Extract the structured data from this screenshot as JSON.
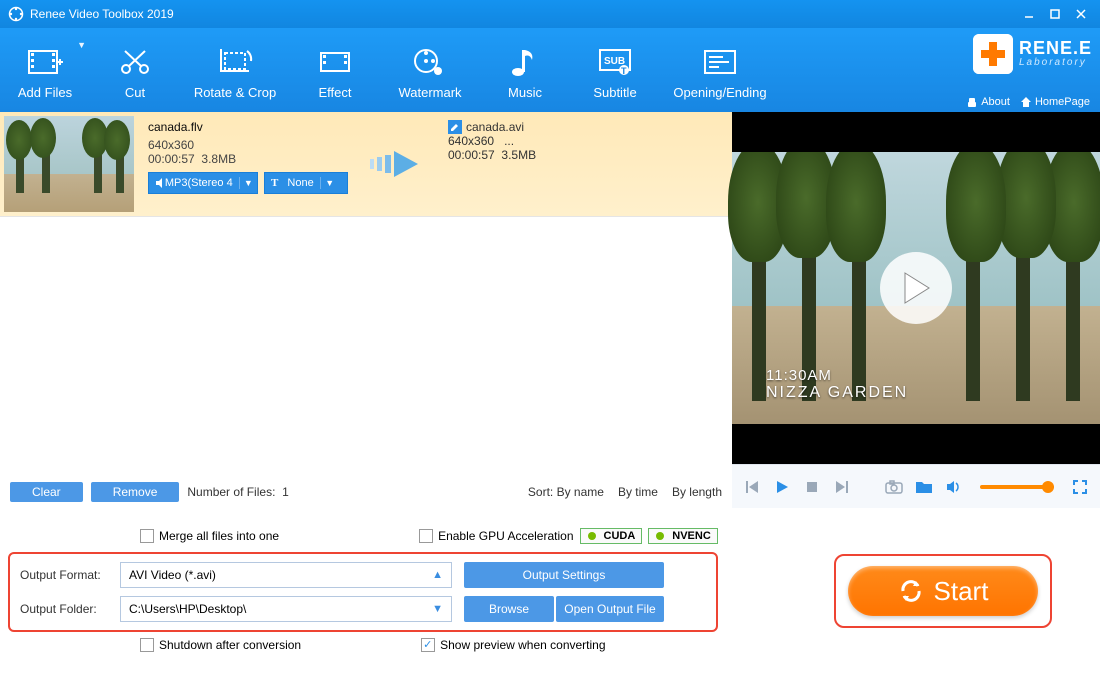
{
  "titlebar": {
    "title": "Renee Video Toolbox 2019"
  },
  "toolbar": {
    "items": [
      {
        "label": "Add Files",
        "icon": "film-add"
      },
      {
        "label": "Cut",
        "icon": "scissors"
      },
      {
        "label": "Rotate & Crop",
        "icon": "crop"
      },
      {
        "label": "Effect",
        "icon": "film"
      },
      {
        "label": "Watermark",
        "icon": "watermark"
      },
      {
        "label": "Music",
        "icon": "music"
      },
      {
        "label": "Subtitle",
        "icon": "subtitle"
      },
      {
        "label": "Opening/Ending",
        "icon": "opening"
      }
    ],
    "brand": {
      "name": "RENE.E",
      "sub": "Laboratory",
      "about": "About",
      "homepage": "HomePage"
    }
  },
  "file": {
    "src": {
      "name": "canada.flv",
      "dim": "640x360",
      "dur": "00:00:57",
      "size": "3.8MB",
      "audio": "MP3(Stereo 4",
      "sub": "None"
    },
    "dst": {
      "name": "canada.avi",
      "dim": "640x360",
      "dim_extra": "...",
      "dur": "00:00:57",
      "size": "3.5MB",
      "extra": "-"
    }
  },
  "preview": {
    "time": "11:30AM",
    "place": "NIZZA GARDEN"
  },
  "listbar": {
    "clear": "Clear",
    "remove": "Remove",
    "count_label": "Number of Files:",
    "count": "1",
    "sort_label": "Sort:",
    "sort1": "By name",
    "sort2": "By time",
    "sort3": "By length"
  },
  "options": {
    "merge": "Merge all files into one",
    "gpu": "Enable GPU Acceleration",
    "cuda": "CUDA",
    "nvenc": "NVENC",
    "format_label": "Output Format:",
    "format_value": "AVI Video (*.avi)",
    "output_settings": "Output Settings",
    "folder_label": "Output Folder:",
    "folder_value": "C:\\Users\\HP\\Desktop\\",
    "browse": "Browse",
    "open_output": "Open Output File",
    "shutdown": "Shutdown after conversion",
    "show_preview": "Show preview when converting"
  },
  "start": {
    "label": "Start"
  }
}
